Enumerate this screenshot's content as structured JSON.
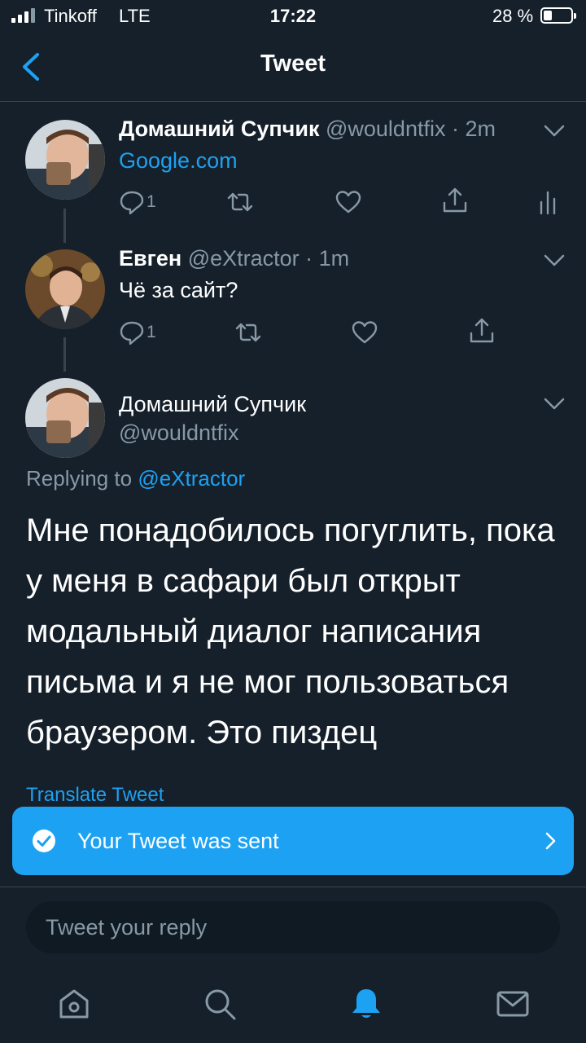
{
  "status_bar": {
    "carrier": "Tinkoff",
    "network": "LTE",
    "time": "17:22",
    "battery": "28 %"
  },
  "nav": {
    "title": "Tweet"
  },
  "tweets": [
    {
      "name": "Домашний Супчик",
      "handle": "@wouldntfix",
      "age": "2m",
      "text": "Google.com",
      "reply_count": "1"
    },
    {
      "name": "Евген",
      "handle": "@eXtractor",
      "age": "1m",
      "text": "Чё за сайт?",
      "reply_count": "1"
    }
  ],
  "main_tweet": {
    "name": "Домашний Супчик",
    "handle": "@wouldntfix",
    "replying_prefix": "Replying to",
    "replying_to": "@eXtractor",
    "text": "Мне понадобилось погуглить, пока у меня в сафари был открыт модальный диалог написания письма и я не мог пользоваться браузером. Это пиздец",
    "translate_label": "Translate Tweet"
  },
  "toast": {
    "message": "Your Tweet was sent"
  },
  "reply_box": {
    "placeholder": "Tweet your reply"
  },
  "tabs": [
    "home-icon",
    "search-icon",
    "notifications-icon",
    "messages-icon"
  ],
  "colors": {
    "background": "#15202b",
    "accent": "#1da1f2",
    "muted": "#8899a6",
    "divider": "#38444d"
  }
}
